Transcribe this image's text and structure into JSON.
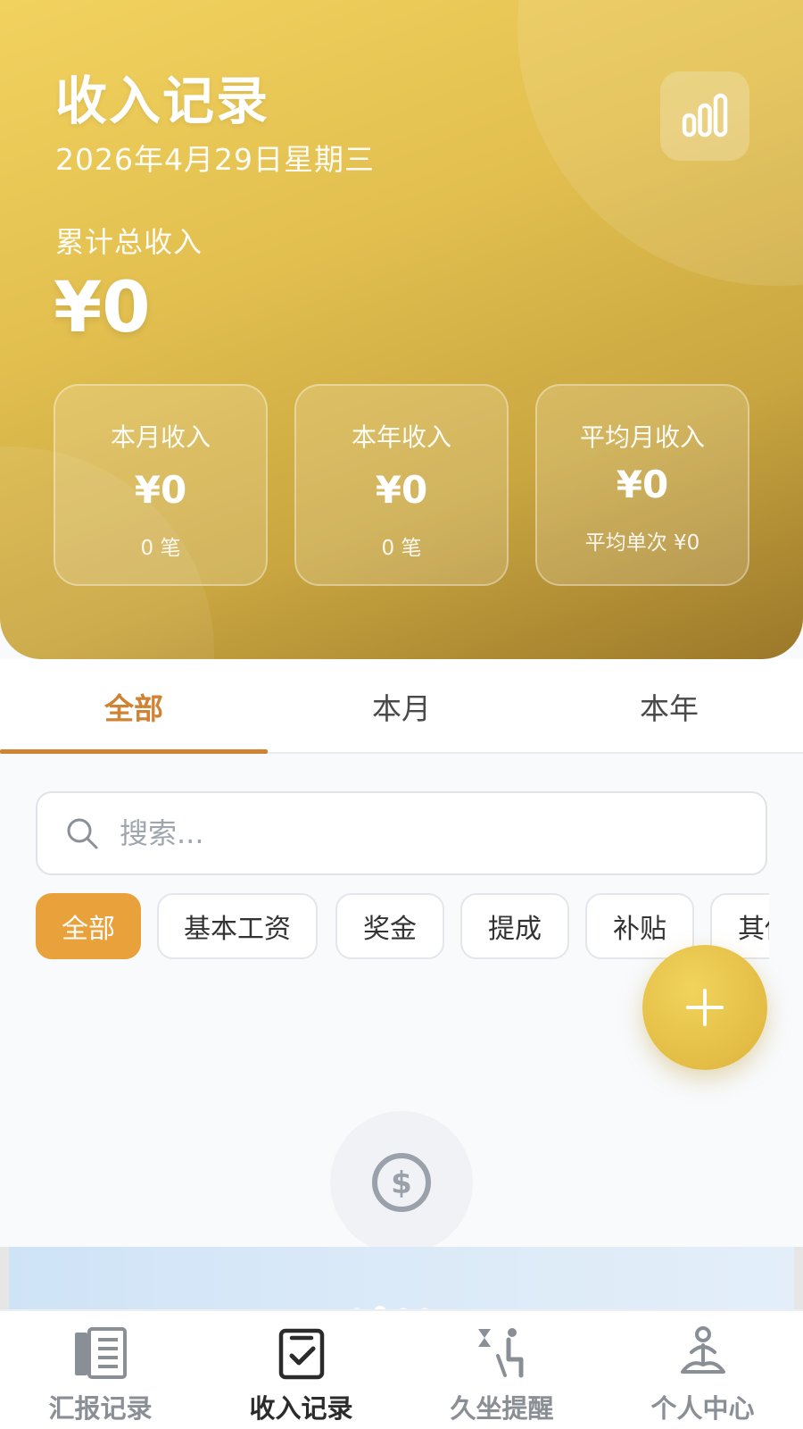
{
  "header": {
    "title": "收入记录",
    "date": "2026年4月29日星期三",
    "total_label": "累计总收入",
    "total_value": "¥0"
  },
  "stats": [
    {
      "label": "本月收入",
      "value": "¥0",
      "sub": "0 笔"
    },
    {
      "label": "本年收入",
      "value": "¥0",
      "sub": "0 笔"
    },
    {
      "label": "平均月收入",
      "value": "¥0",
      "sub": "平均单次 ¥0"
    }
  ],
  "tabs": [
    {
      "label": "全部",
      "active": true
    },
    {
      "label": "本月",
      "active": false
    },
    {
      "label": "本年",
      "active": false
    }
  ],
  "search": {
    "placeholder": "搜索...",
    "value": ""
  },
  "chips": [
    {
      "label": "全部",
      "active": true
    },
    {
      "label": "基本工资",
      "active": false
    },
    {
      "label": "奖金",
      "active": false
    },
    {
      "label": "提成",
      "active": false
    },
    {
      "label": "补贴",
      "active": false
    },
    {
      "label": "其他",
      "active": false
    }
  ],
  "bottom_nav": [
    {
      "label": "汇报记录",
      "icon": "report-icon",
      "active": false
    },
    {
      "label": "收入记录",
      "icon": "income-icon",
      "active": true
    },
    {
      "label": "久坐提醒",
      "icon": "sitting-reminder-icon",
      "active": false
    },
    {
      "label": "个人中心",
      "icon": "profile-icon",
      "active": false
    }
  ],
  "colors": {
    "accent": "#cf8335",
    "chip_active": "#e9a23b",
    "header_gold": "#e2bf4f",
    "fab_gold": "#e3bd45"
  }
}
